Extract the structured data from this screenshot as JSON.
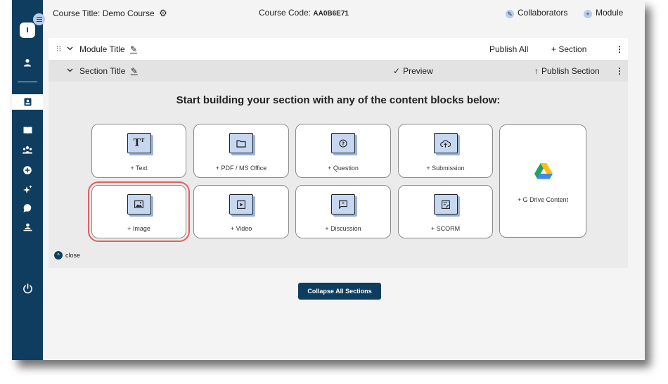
{
  "topbar": {
    "course_title": "Course Title: Demo Course",
    "course_code_label": "Course Code:",
    "course_code": "AA0B6E71",
    "collaborators": "Collaborators",
    "module": "Module"
  },
  "sidebar": {
    "logo": "I",
    "icons": [
      "user-icon",
      "contact-book-icon",
      "book-icon",
      "people-icon",
      "add-circle-icon",
      "sparkle-icon",
      "chat-icon",
      "teacher-icon",
      "power-icon"
    ]
  },
  "module_bar": {
    "title": "Module Title",
    "publish_all": "Publish All",
    "add_section": "+ Section"
  },
  "section_bar": {
    "title": "Section Title",
    "preview": "Preview",
    "publish_section": "Publish Section"
  },
  "content": {
    "heading": "Start building your section with any of the content blocks below:",
    "blocks": {
      "text": "+ Text",
      "pdf": "+ PDF / MS Office",
      "question": "+ Question",
      "submission": "+ Submission",
      "image": "+ Image",
      "video": "+ Video",
      "discussion": "+ Discussion",
      "scorm": "+ SCORM",
      "gdrive": "+ G Drive Content"
    },
    "selected_block": "image",
    "close": "close"
  },
  "collapse_all": "Collapse All Sections",
  "colors": {
    "sidebar": "#0f3d5f",
    "icon_fill": "#c6d7f0",
    "selected_outline": "#e06060"
  }
}
